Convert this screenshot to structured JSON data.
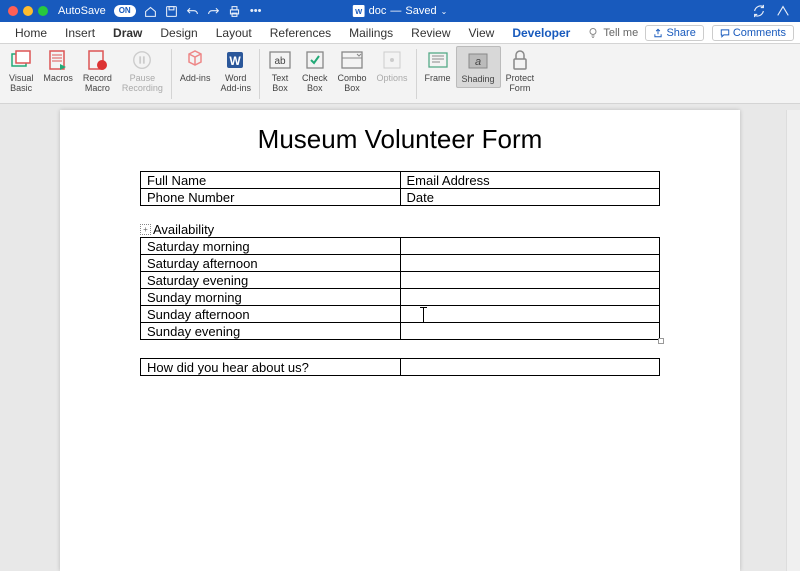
{
  "titlebar": {
    "autosave_label": "AutoSave",
    "autosave_state": "ON",
    "doc_name": "doc",
    "save_state": "Saved"
  },
  "menu": {
    "tabs": [
      "Home",
      "Insert",
      "Draw",
      "Design",
      "Layout",
      "References",
      "Mailings",
      "Review",
      "View",
      "Developer"
    ],
    "active": "Developer",
    "bold_extra": "Draw",
    "tell_me": "Tell me",
    "share": "Share",
    "comments": "Comments"
  },
  "ribbon": {
    "visual_basic": "Visual\nBasic",
    "macros": "Macros",
    "record_macro": "Record\nMacro",
    "pause_recording": "Pause\nRecording",
    "addins": "Add-ins",
    "word_addins": "Word\nAdd-ins",
    "text_box": "Text\nBox",
    "check_box": "Check\nBox",
    "combo_box": "Combo\nBox",
    "options": "Options",
    "frame": "Frame",
    "shading": "Shading",
    "protect_form": "Protect\nForm"
  },
  "doc": {
    "title": "Museum Volunteer Form",
    "contact": {
      "full_name": "Full Name",
      "email": "Email Address",
      "phone": "Phone Number",
      "date": "Date"
    },
    "availability_label": "Availability",
    "availability": [
      "Saturday morning",
      "Saturday afternoon",
      "Saturday evening",
      "Sunday morning",
      "Sunday afternoon",
      "Sunday evening"
    ],
    "how_hear": "How did you hear about us?"
  }
}
